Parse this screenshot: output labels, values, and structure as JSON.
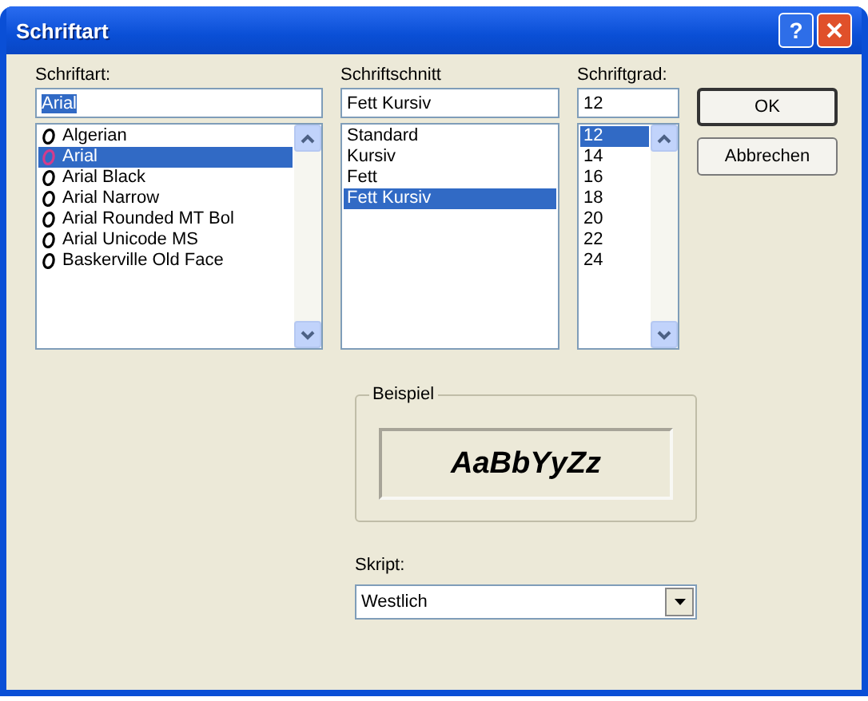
{
  "window": {
    "title": "Schriftart",
    "help": "?"
  },
  "font": {
    "label": "Schriftart:",
    "value": "Arial",
    "value_selected": true,
    "items": [
      {
        "label": "Algerian",
        "selected": false
      },
      {
        "label": "Arial",
        "selected": true
      },
      {
        "label": "Arial Black",
        "selected": false
      },
      {
        "label": "Arial Narrow",
        "selected": false
      },
      {
        "label": "Arial Rounded MT Bol",
        "selected": false
      },
      {
        "label": "Arial Unicode MS",
        "selected": false
      },
      {
        "label": "Baskerville Old Face",
        "selected": false
      }
    ]
  },
  "style": {
    "label": "Schriftschnitt",
    "value": "Fett Kursiv",
    "items": [
      {
        "label": "Standard",
        "selected": false
      },
      {
        "label": "Kursiv",
        "selected": false
      },
      {
        "label": "Fett",
        "selected": false
      },
      {
        "label": "Fett Kursiv",
        "selected": true
      }
    ]
  },
  "size": {
    "label": "Schriftgrad:",
    "value": "12",
    "items": [
      {
        "label": "12",
        "selected": true
      },
      {
        "label": "14",
        "selected": false
      },
      {
        "label": "16",
        "selected": false
      },
      {
        "label": "18",
        "selected": false
      },
      {
        "label": "20",
        "selected": false
      },
      {
        "label": "22",
        "selected": false
      },
      {
        "label": "24",
        "selected": false
      }
    ]
  },
  "buttons": [
    {
      "label": "OK",
      "default": true
    },
    {
      "label": "Abbrechen",
      "default": false
    }
  ],
  "sample": {
    "label": "Beispiel",
    "text": "AaBbYyZz"
  },
  "script": {
    "label": "Skript:",
    "value": "Westlich"
  }
}
